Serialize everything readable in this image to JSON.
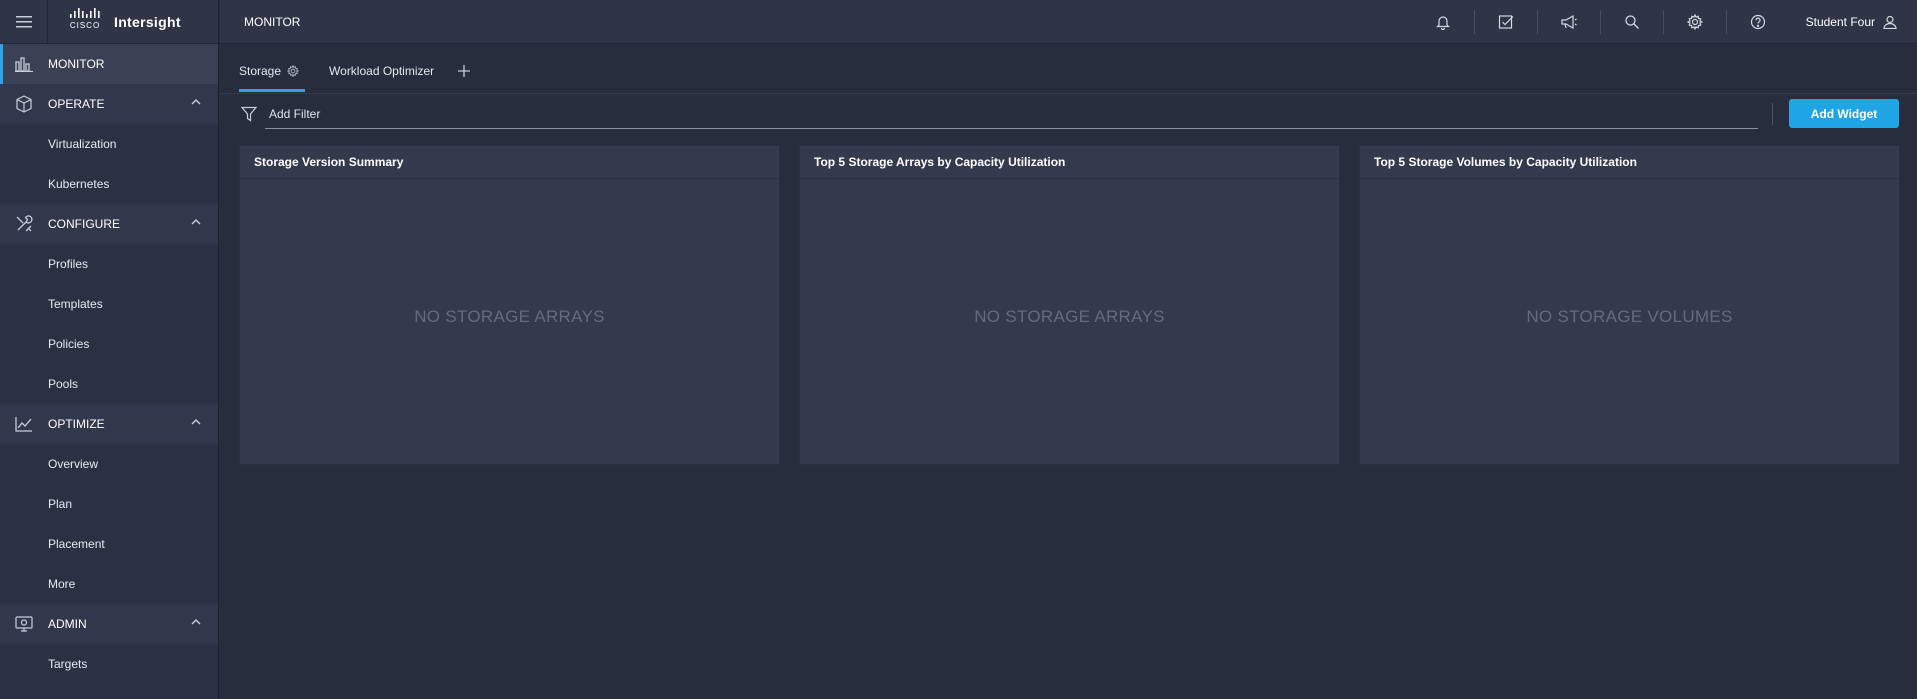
{
  "brand": {
    "logo_text": "CISCO",
    "title": "Intersight"
  },
  "topbar": {
    "title": "MONITOR",
    "icons": [
      "bell-icon",
      "tasks-check-icon",
      "megaphone-icon",
      "search-icon",
      "gear-icon",
      "help-icon"
    ],
    "user_name": "Student Four"
  },
  "sidebar": {
    "monitor": {
      "label": "MONITOR"
    },
    "operate": {
      "label": "OPERATE",
      "items": [
        "Virtualization",
        "Kubernetes"
      ]
    },
    "configure": {
      "label": "CONFIGURE",
      "items": [
        "Profiles",
        "Templates",
        "Policies",
        "Pools"
      ]
    },
    "optimize": {
      "label": "OPTIMIZE",
      "items": [
        "Overview",
        "Plan",
        "Placement",
        "More"
      ]
    },
    "admin": {
      "label": "ADMIN",
      "items": [
        "Targets"
      ]
    }
  },
  "tabs": [
    {
      "label": "Storage",
      "active": true
    },
    {
      "label": "Workload Optimizer",
      "active": false
    }
  ],
  "filter": {
    "placeholder": "Add Filter"
  },
  "add_widget_label": "Add Widget",
  "widgets": [
    {
      "title": "Storage Version Summary",
      "empty_text": "NO STORAGE ARRAYS"
    },
    {
      "title": "Top 5 Storage Arrays by Capacity Utilization",
      "empty_text": "NO STORAGE ARRAYS"
    },
    {
      "title": "Top 5 Storage Volumes by Capacity Utilization",
      "empty_text": "NO STORAGE VOLUMES"
    }
  ],
  "colors": {
    "accent": "#2fa3e9",
    "button": "#1fa4e5",
    "background": "#272d3d",
    "sidebar": "#2b3142"
  }
}
